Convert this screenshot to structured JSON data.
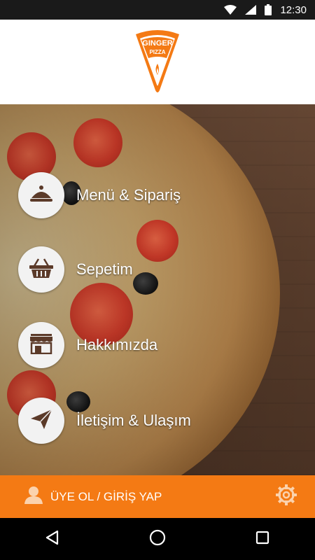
{
  "status_bar": {
    "time": "12:30",
    "icons": [
      "wifi-icon",
      "cellular-signal-icon",
      "battery-icon"
    ]
  },
  "header": {
    "logo_text_top": "GINGER",
    "logo_text_bottom": "PIZZA",
    "brand_color": "#F47A14"
  },
  "menu": [
    {
      "label": "Menü & Sipariş",
      "icon": "cloche-icon"
    },
    {
      "label": "Sepetim",
      "icon": "basket-icon"
    },
    {
      "label": "Hakkımızda",
      "icon": "store-icon"
    },
    {
      "label": "İletişim & Ulaşım",
      "icon": "paper-plane-icon"
    }
  ],
  "bottom_bar": {
    "login_label": "ÜYE OL / GİRİŞ YAP",
    "user_icon": "user-icon",
    "settings_icon": "gear-icon",
    "color": "#F47A14"
  },
  "nav_bar": {
    "buttons": [
      "back-icon",
      "home-icon",
      "recents-icon"
    ]
  }
}
